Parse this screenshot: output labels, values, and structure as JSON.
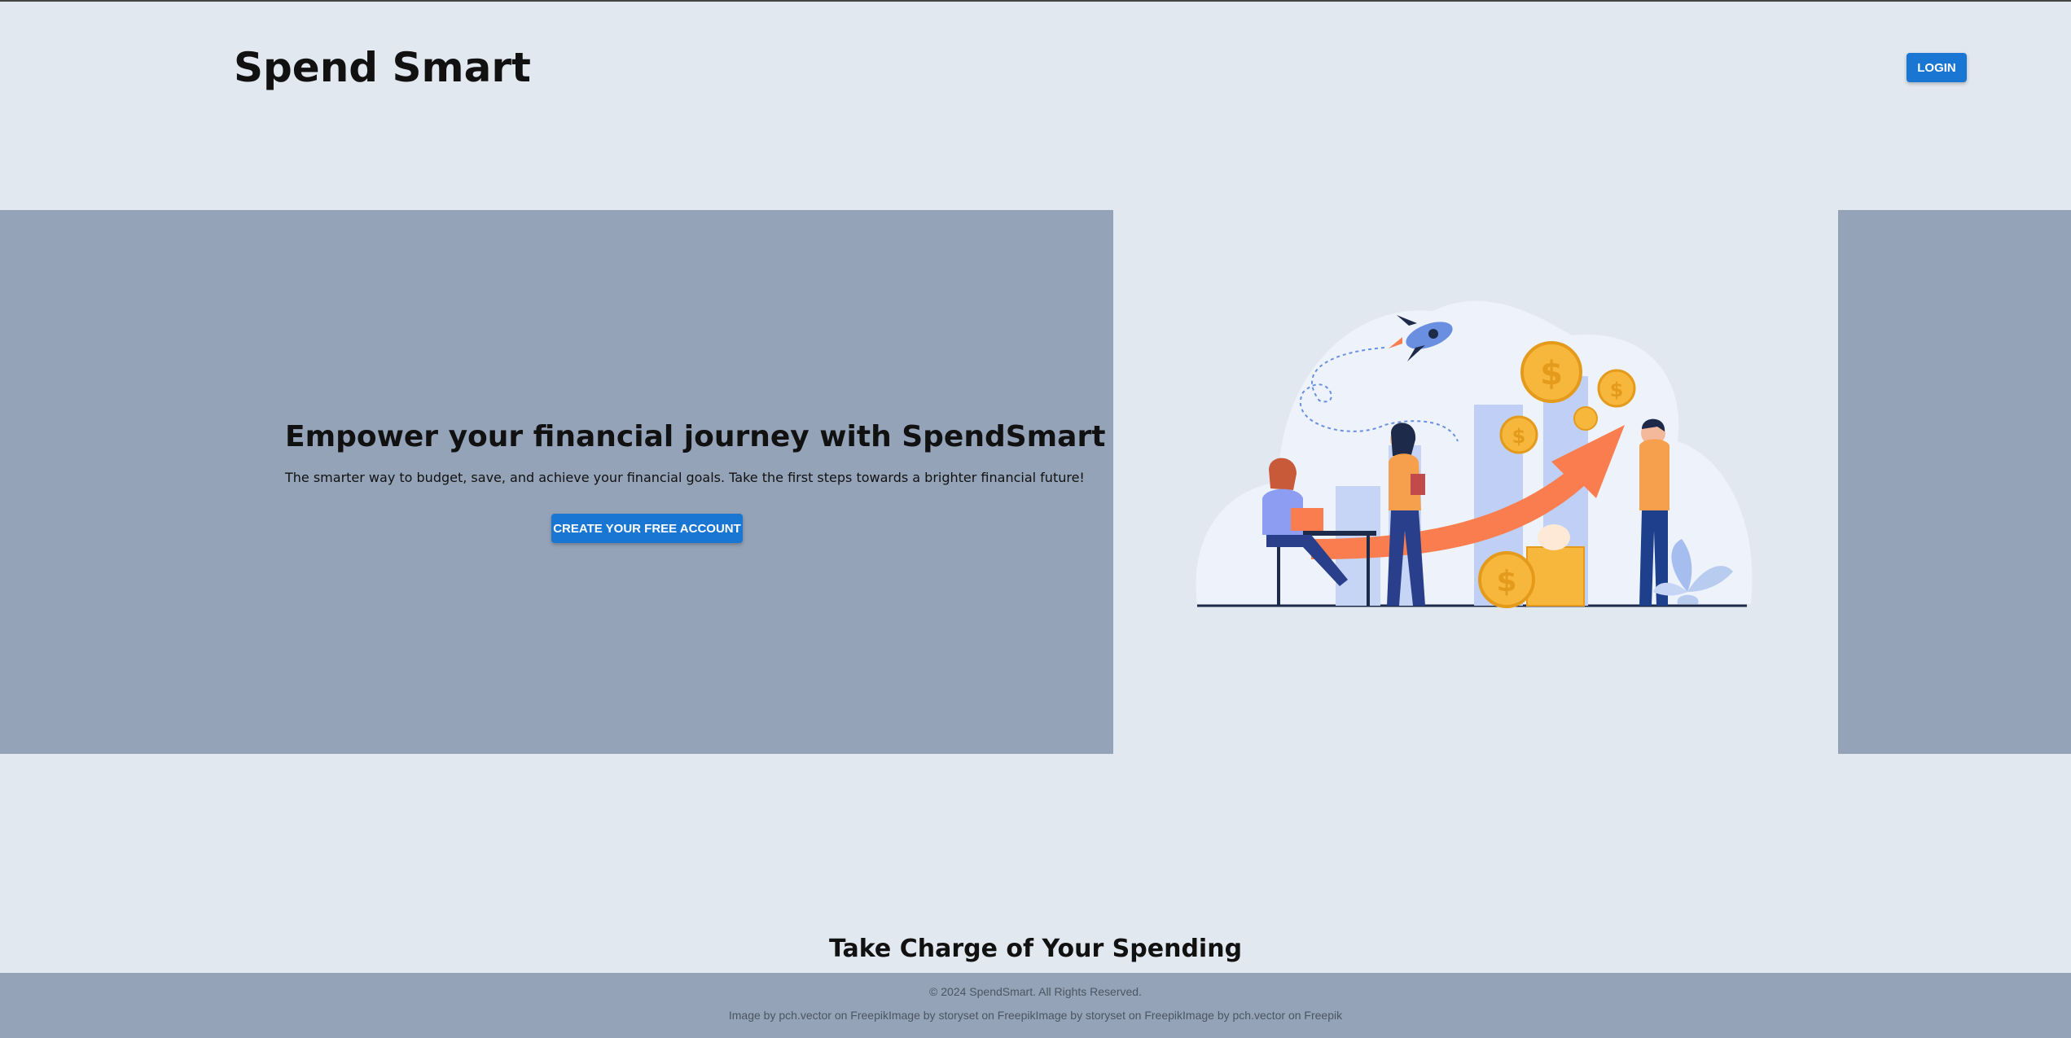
{
  "header": {
    "brand": "Spend Smart",
    "login_label": "LOGIN"
  },
  "hero": {
    "title": "Empower your financial journey with SpendSmart",
    "subtitle": "The smarter way to budget, save, and achieve your financial goals. Take the first steps towards a brighter financial future!",
    "cta_label": "CREATE YOUR FREE ACCOUNT"
  },
  "section": {
    "title": "Take Charge of Your Spending"
  },
  "footer": {
    "copyright": "© 2024 SpendSmart. All Rights Reserved.",
    "credits": "Image by pch.vector on FreepikImage by storyset on FreepikImage by storyset on FreepikImage by pch.vector on Freepik"
  },
  "colors": {
    "background": "#e2e8f0",
    "panel": "#94a3b8",
    "primary": "#1976d2",
    "accent_orange": "#f97d4f",
    "coin_gold": "#f6b73c"
  },
  "icons": [
    "rocket-icon",
    "dollar-coin-icon",
    "growth-arrow-icon",
    "plant-icon"
  ]
}
